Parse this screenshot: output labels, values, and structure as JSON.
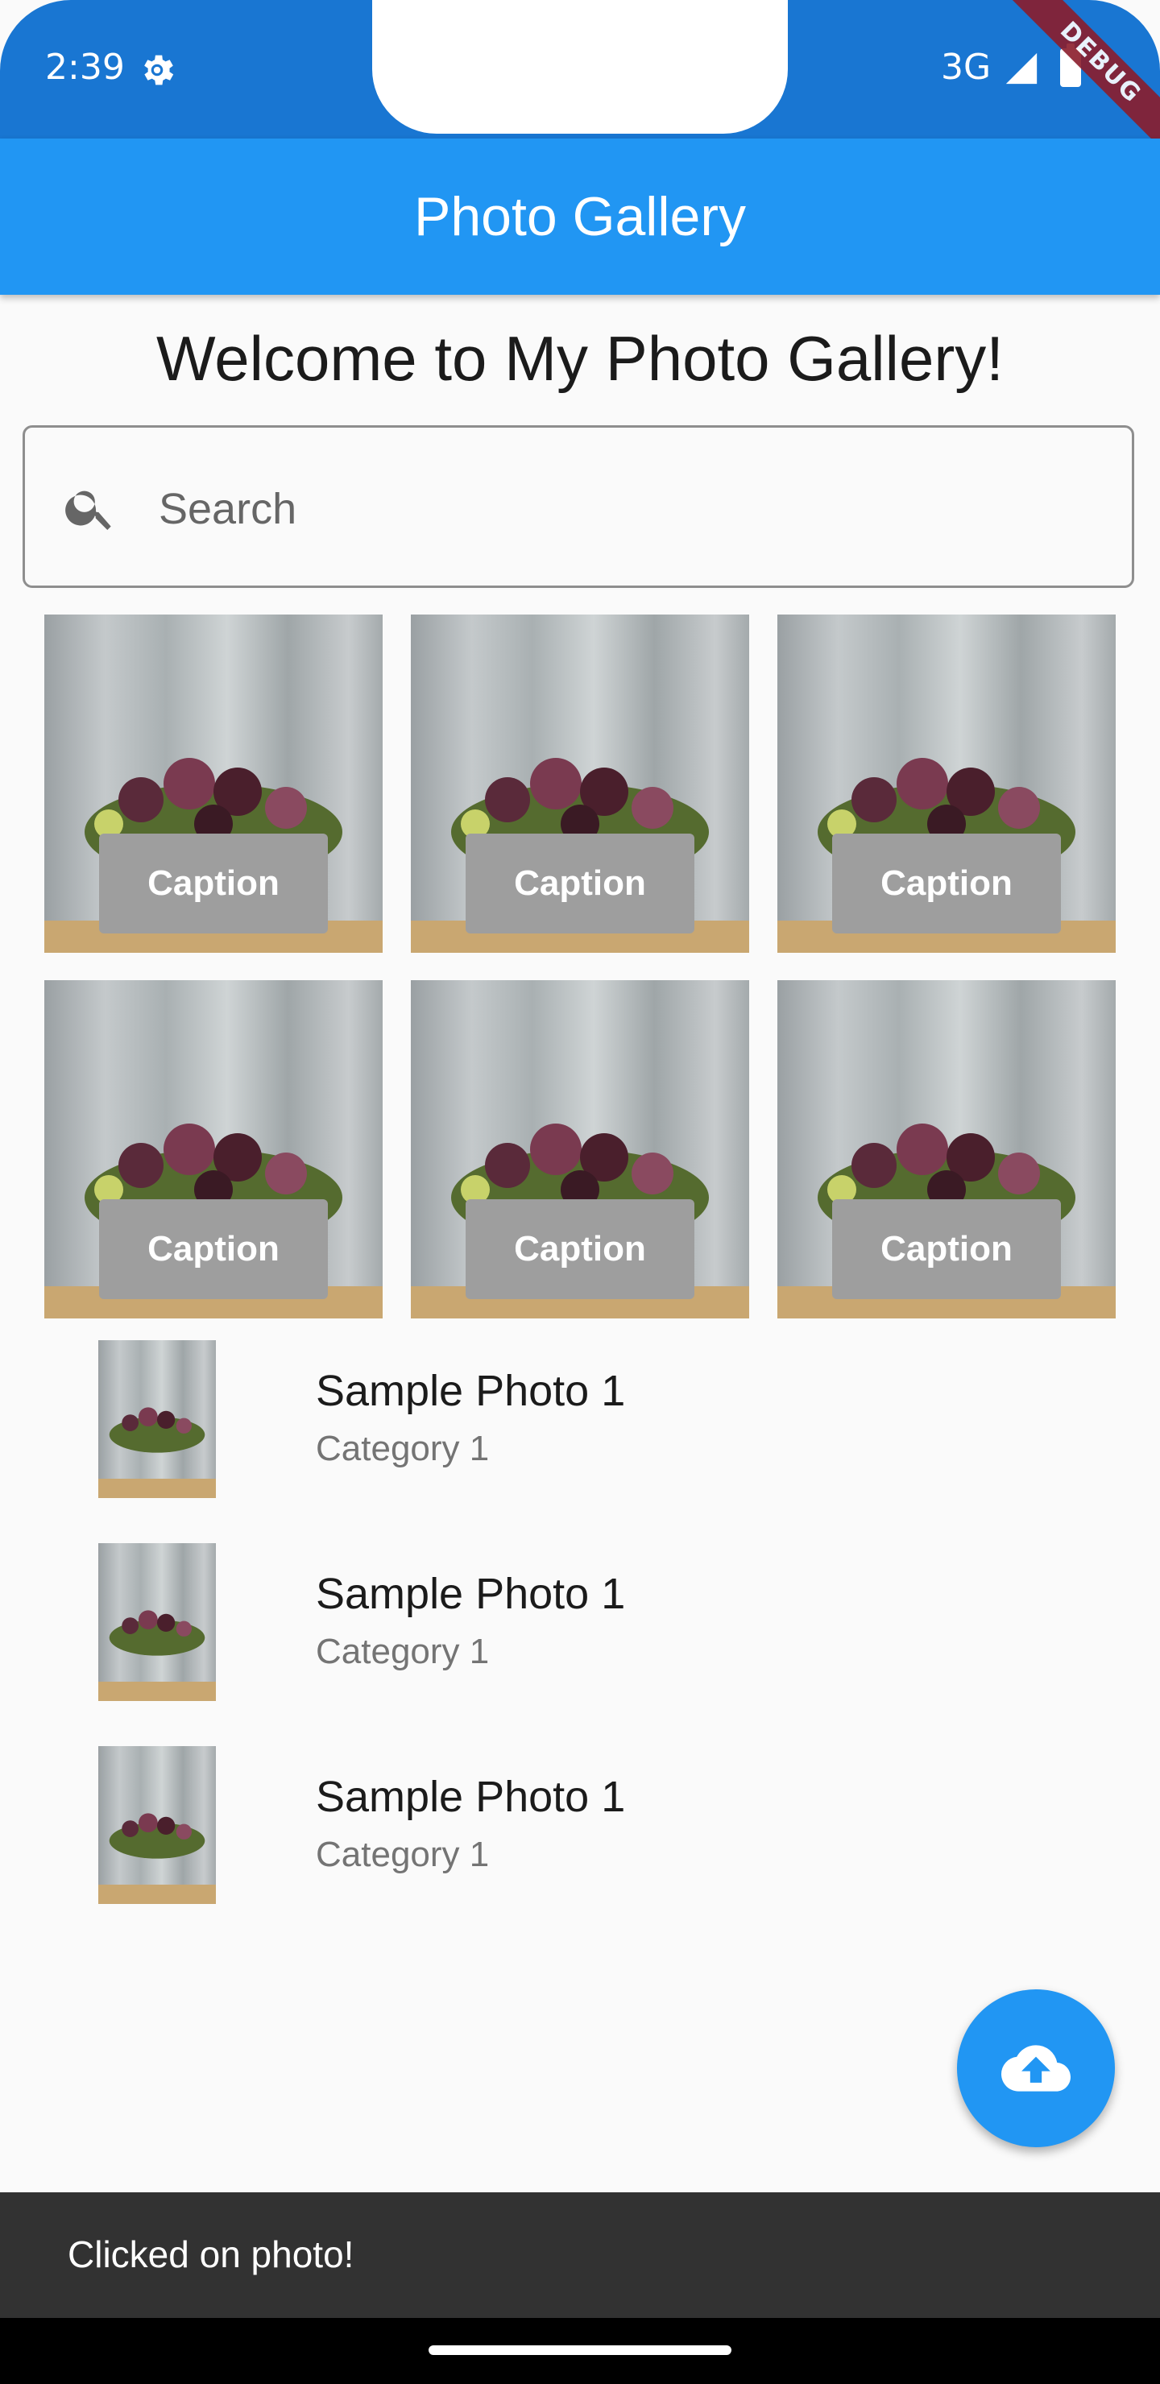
{
  "status_bar": {
    "time": "2:39",
    "network": "3G",
    "debug": "DEBUG",
    "icons": [
      "settings-icon",
      "signal-icon",
      "battery-icon"
    ]
  },
  "app_bar": {
    "title": "Photo Gallery"
  },
  "welcome": "Welcome to My Photo Gallery!",
  "search": {
    "placeholder": "Search",
    "value": "",
    "icon": "search-icon"
  },
  "grid": {
    "items": [
      {
        "caption": "Caption"
      },
      {
        "caption": "Caption"
      },
      {
        "caption": "Caption"
      },
      {
        "caption": "Caption"
      },
      {
        "caption": "Caption"
      },
      {
        "caption": "Caption"
      }
    ]
  },
  "list": {
    "items": [
      {
        "title": "Sample Photo 1",
        "category": "Category 1"
      },
      {
        "title": "Sample Photo 1",
        "category": "Category 1"
      },
      {
        "title": "Sample Photo 1",
        "category": "Category 1"
      }
    ]
  },
  "fab": {
    "icon": "cloud-upload-icon"
  },
  "snackbar": {
    "message": "Clicked on photo!"
  },
  "colors": {
    "primary": "#2196f3",
    "primary_dark": "#1976d2",
    "snackbar": "#323232",
    "caption_bg": "#9e9e9e"
  }
}
